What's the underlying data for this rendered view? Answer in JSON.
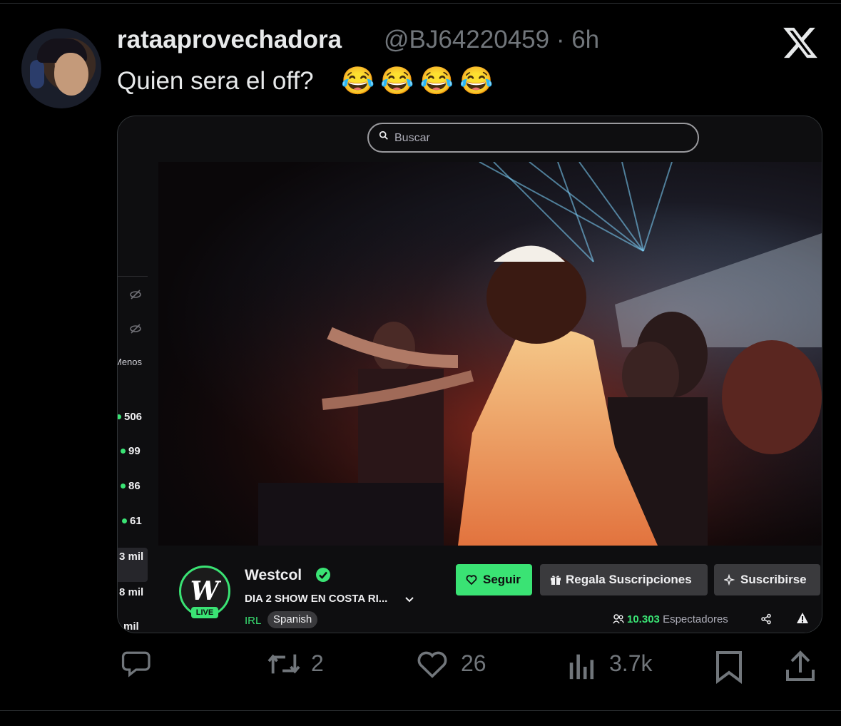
{
  "tweet": {
    "display_name": "rataaprovechadora",
    "handle_time": "@BJ64220459 · 6h",
    "text": "Quien sera el off?",
    "emojis": "😂😂😂😂",
    "platform_logo": "x-logo-icon"
  },
  "stream_ui": {
    "search_placeholder": "Buscar",
    "sidebar": {
      "menos_label": "Menos",
      "counts": [
        "506",
        "99",
        "86",
        "61"
      ],
      "mil_counts": [
        "3 mil",
        "8 mil",
        "mil"
      ]
    },
    "channel": {
      "name": "Westcol",
      "avatar_letter": "W",
      "live_badge": "LIVE",
      "title": "DIA 2 SHOW EN COSTA RI...",
      "category": "IRL",
      "language": "Spanish"
    },
    "buttons": {
      "follow": "Seguir",
      "gift": "Regala Suscripciones",
      "subscribe": "Suscribirse"
    },
    "viewers": {
      "count": "10.303",
      "label": "Espectadores"
    },
    "colors": {
      "accent_green": "#3ae374",
      "button_gray": "#3a3a3d",
      "background": "#0e0e10"
    }
  },
  "actions": {
    "replies": "",
    "retweets": "2",
    "likes": "26",
    "views": "3.7k"
  }
}
